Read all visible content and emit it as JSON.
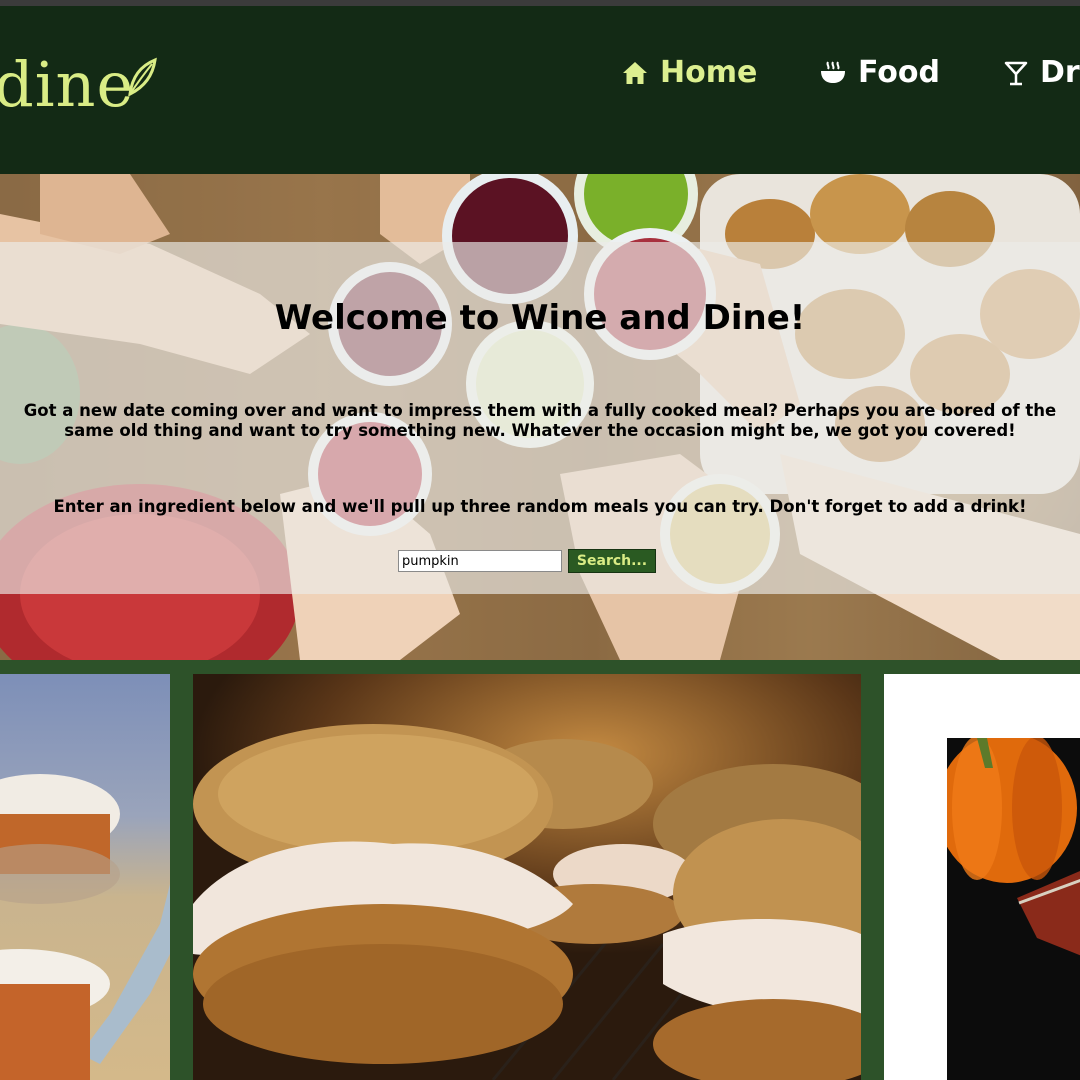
{
  "nav": {
    "logo_text": "dine",
    "items": [
      {
        "label": "Home",
        "icon": "home-icon",
        "active": true
      },
      {
        "label": "Food",
        "icon": "bowl-icon",
        "active": false
      },
      {
        "label": "Dr",
        "icon": "cocktail-glass-icon",
        "active": false
      }
    ]
  },
  "hero": {
    "title": "Welcome to Wine and Dine!",
    "paragraph_1": "Got a new date coming over and want to impress them with a fully cooked meal? Perhaps you are bored of the same old thing and want to try something new. Whatever the occasion might be, we got you covered!",
    "paragraph_2": "Enter an ingredient below and we'll pull up three random meals you can try. Don't forget to add a drink!",
    "search": {
      "value": "pumpkin",
      "button_label": "Search..."
    }
  },
  "colors": {
    "nav_bg": "#132a15",
    "accent": "#d9ec85",
    "page_bg": "#2d5229",
    "button_bg": "#2a5a22"
  }
}
